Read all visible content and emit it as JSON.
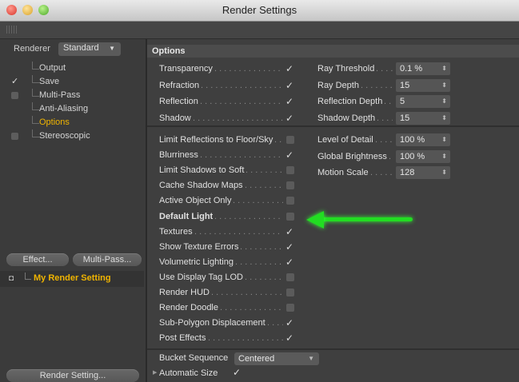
{
  "window": {
    "title": "Render Settings"
  },
  "left": {
    "renderer_label": "Renderer",
    "renderer_value": "Standard",
    "tree": [
      {
        "label": "Output",
        "enabled": null,
        "selected": false
      },
      {
        "label": "Save",
        "enabled": true,
        "selected": false
      },
      {
        "label": "Multi-Pass",
        "enabled": false,
        "selected": false
      },
      {
        "label": "Anti-Aliasing",
        "enabled": null,
        "selected": false
      },
      {
        "label": "Options",
        "enabled": null,
        "selected": true
      },
      {
        "label": "Stereoscopic",
        "enabled": false,
        "selected": false
      }
    ],
    "effect_button": "Effect...",
    "multipass_button": "Multi-Pass...",
    "render_setting_item": "My Render Setting",
    "render_setting_button": "Render Setting..."
  },
  "options": {
    "header": "Options",
    "check_group_1": [
      {
        "label": "Transparency",
        "checked": true
      },
      {
        "label": "Refraction",
        "checked": true
      },
      {
        "label": "Reflection",
        "checked": true
      },
      {
        "label": "Shadow",
        "checked": true
      }
    ],
    "fields_group_1": [
      {
        "label": "Ray Threshold",
        "value": "0.1 %"
      },
      {
        "label": "Ray Depth",
        "value": "15"
      },
      {
        "label": "Reflection Depth",
        "value": "5"
      },
      {
        "label": "Shadow Depth",
        "value": "15"
      }
    ],
    "check_group_2": [
      {
        "label": "Limit Reflections to Floor/Sky",
        "checked": false
      },
      {
        "label": "Blurriness",
        "checked": true
      },
      {
        "label": "Limit Shadows to Soft",
        "checked": false
      },
      {
        "label": "Cache Shadow Maps",
        "checked": false
      },
      {
        "label": "Active Object Only",
        "checked": false
      },
      {
        "label": "Default Light",
        "checked": false,
        "bold": true
      },
      {
        "label": "Textures",
        "checked": true
      },
      {
        "label": "Show Texture Errors",
        "checked": true
      },
      {
        "label": "Volumetric Lighting",
        "checked": true
      },
      {
        "label": "Use Display Tag LOD",
        "checked": false
      },
      {
        "label": "Render HUD",
        "checked": false
      },
      {
        "label": "Render Doodle",
        "checked": false
      },
      {
        "label": "Sub-Polygon Displacement",
        "checked": true
      },
      {
        "label": "Post Effects",
        "checked": true
      }
    ],
    "fields_group_2": [
      {
        "label": "Level of Detail",
        "value": "100 %"
      },
      {
        "label": "Global Brightness",
        "value": "100 %"
      },
      {
        "label": "Motion Scale",
        "value": "128"
      }
    ],
    "bucket_label": "Bucket Sequence",
    "bucket_value": "Centered",
    "auto_size_label": "Automatic Size",
    "auto_size_checked": true
  },
  "colors": {
    "selected": "#f0b400",
    "annotation_arrow": "#22dd22"
  }
}
